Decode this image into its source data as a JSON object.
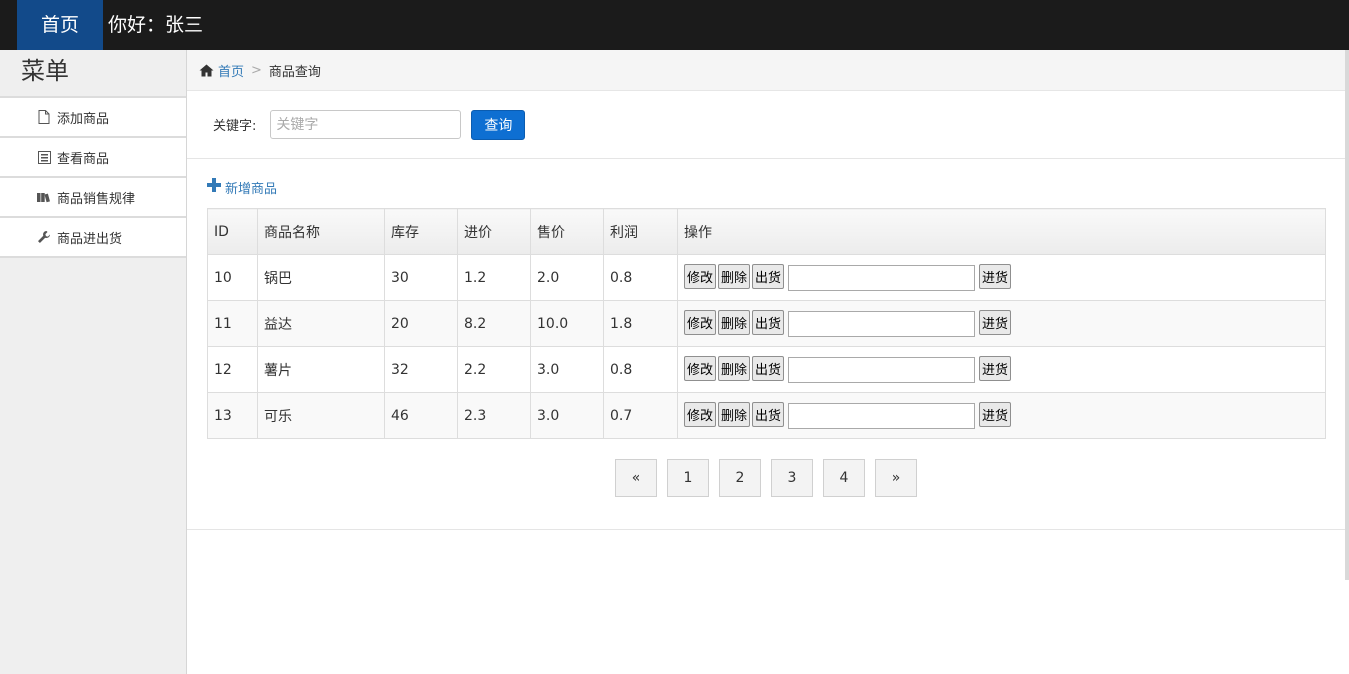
{
  "topbar": {
    "home_label": "首页",
    "greeting": "你好：张三"
  },
  "sidebar": {
    "title": "菜单",
    "items": [
      {
        "label": "添加商品",
        "icon": "file-icon"
      },
      {
        "label": "查看商品",
        "icon": "list-icon"
      },
      {
        "label": "商品销售规律",
        "icon": "books-icon"
      },
      {
        "label": "商品进出货",
        "icon": "wrench-icon"
      }
    ]
  },
  "breadcrumb": {
    "home": "首页",
    "separator": ">",
    "current": "商品查询"
  },
  "search": {
    "label": "关键字:",
    "placeholder": "关键字",
    "value": "",
    "button": "查询"
  },
  "add_link": "新增商品",
  "table": {
    "headers": [
      "ID",
      "商品名称",
      "库存",
      "进价",
      "售价",
      "利润",
      "操作"
    ],
    "rows": [
      {
        "id": "10",
        "name": "锅巴",
        "stock": "30",
        "cost": "1.2",
        "price": "2.0",
        "profit": "0.8"
      },
      {
        "id": "11",
        "name": "益达",
        "stock": "20",
        "cost": "8.2",
        "price": "10.0",
        "profit": "1.8"
      },
      {
        "id": "12",
        "name": "薯片",
        "stock": "32",
        "cost": "2.2",
        "price": "3.0",
        "profit": "0.8"
      },
      {
        "id": "13",
        "name": "可乐",
        "stock": "46",
        "cost": "2.3",
        "price": "3.0",
        "profit": "0.7"
      }
    ],
    "actions": {
      "edit": "修改",
      "delete": "删除",
      "ship_out": "出货",
      "stock_in": "进货"
    }
  },
  "pagination": {
    "prev": "«",
    "pages": [
      "1",
      "2",
      "3",
      "4"
    ],
    "next": "»"
  },
  "colors": {
    "topbar": "#1b1b1b",
    "brand": "#124a8a",
    "primary_button": "#0e6fd2",
    "link": "#337ab7"
  }
}
